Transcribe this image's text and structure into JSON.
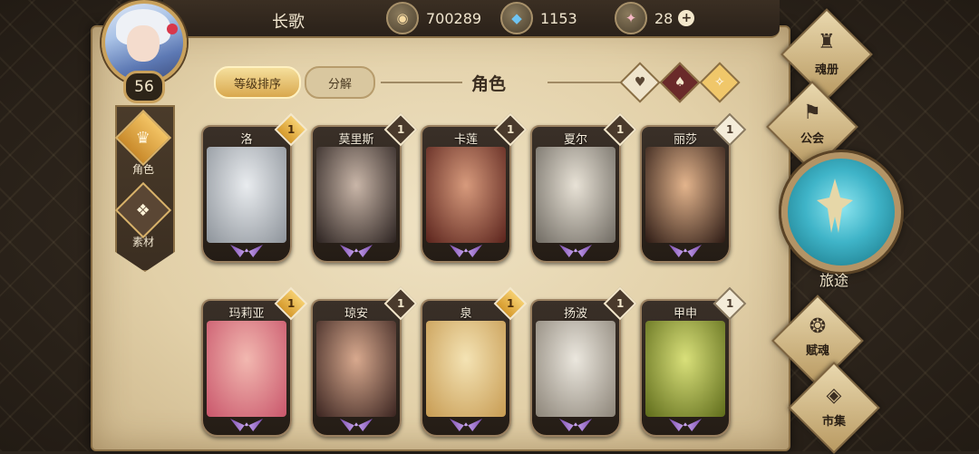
{
  "player": {
    "name": "长歌",
    "level": "56"
  },
  "resources": [
    {
      "icon": "gold-coin-icon",
      "glyph": "◉",
      "value": "700289"
    },
    {
      "icon": "blue-crystal-icon",
      "glyph": "◆",
      "value": "1153"
    },
    {
      "icon": "pink-crystal-icon",
      "glyph": "✦",
      "value": "28"
    }
  ],
  "side_tabs": [
    {
      "label": "角色",
      "glyph": "♛"
    },
    {
      "label": "素材",
      "glyph": "❖"
    }
  ],
  "toolbar": {
    "sort_label": "等级排序",
    "decompose_label": "分解",
    "title": "角色"
  },
  "filters": [
    {
      "icon": "heart-filter-icon",
      "glyph": "♥"
    },
    {
      "icon": "sword-filter-icon",
      "glyph": "♠"
    },
    {
      "icon": "star-filter-icon",
      "glyph": "✧"
    }
  ],
  "characters": [
    {
      "name": "洛",
      "badge": "1",
      "badge_style": "gold",
      "color_a": "#e9ecef",
      "color_b": "#8d939a"
    },
    {
      "name": "莫里斯",
      "badge": "1",
      "badge_style": "dark",
      "color_a": "#c9b6a8",
      "color_b": "#2b2220"
    },
    {
      "name": "卡莲",
      "badge": "1",
      "badge_style": "dark",
      "color_a": "#d79a7c",
      "color_b": "#5a231c"
    },
    {
      "name": "夏尔",
      "badge": "1",
      "badge_style": "dark",
      "color_a": "#e8e2d6",
      "color_b": "#6f6a62"
    },
    {
      "name": "丽莎",
      "badge": "1",
      "badge_style": "light",
      "color_a": "#e3b48c",
      "color_b": "#2c1a14"
    },
    {
      "name": "玛莉亚",
      "badge": "1",
      "badge_style": "gold",
      "color_a": "#f2b8b0",
      "color_b": "#c9566b"
    },
    {
      "name": "琼安",
      "badge": "1",
      "badge_style": "dark",
      "color_a": "#d8a98e",
      "color_b": "#3a2420"
    },
    {
      "name": "泉",
      "badge": "1",
      "badge_style": "gold",
      "color_a": "#f4e3b4",
      "color_b": "#c79b52"
    },
    {
      "name": "扬波",
      "badge": "1",
      "badge_style": "dark",
      "color_a": "#ebe7de",
      "color_b": "#8c8478"
    },
    {
      "name": "甲申",
      "badge": "1",
      "badge_style": "light",
      "color_a": "#d9e07a",
      "color_b": "#5e6b1a"
    }
  ],
  "right_menu": {
    "album": {
      "label": "魂册",
      "glyph": "♜"
    },
    "guild": {
      "label": "公会",
      "glyph": "⚑"
    },
    "journey": {
      "label": "旅途"
    },
    "soul": {
      "label": "赋魂",
      "glyph": "❂"
    },
    "market": {
      "label": "市集",
      "glyph": "◈"
    }
  }
}
